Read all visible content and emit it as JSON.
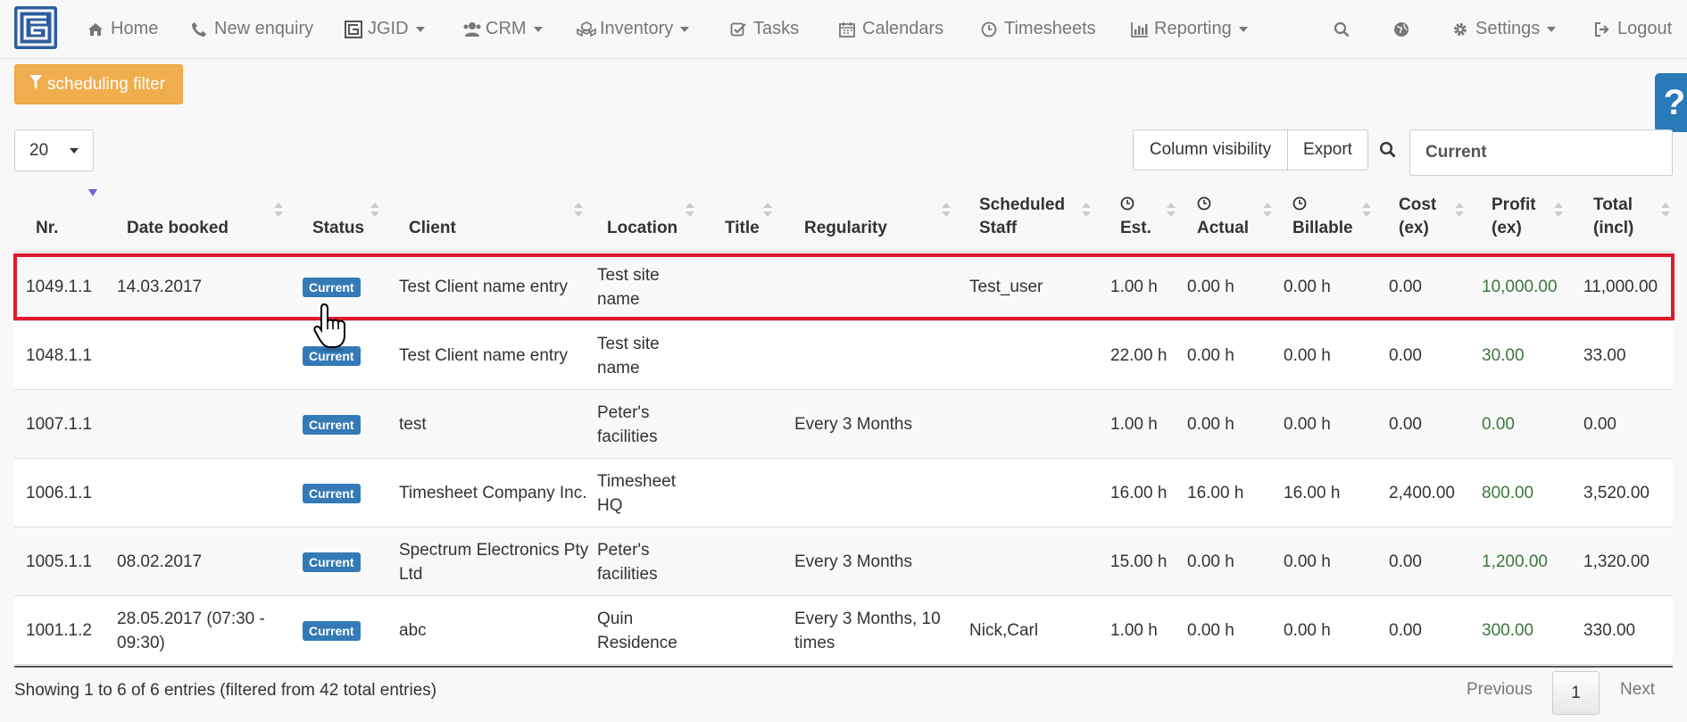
{
  "nav": {
    "home": "Home",
    "new_enquiry": "New enquiry",
    "jgid": "JGID",
    "crm": "CRM",
    "inventory": "Inventory",
    "tasks": "Tasks",
    "calendars": "Calendars",
    "timesheets": "Timesheets",
    "reporting": "Reporting",
    "settings": "Settings",
    "logout": "Logout"
  },
  "filter_button": "scheduling filter",
  "help_label": "?",
  "toolbar": {
    "page_length": "20",
    "column_visibility": "Column visibility",
    "export": "Export",
    "search_value": "Current"
  },
  "table": {
    "headers": {
      "nr": "Nr.",
      "date_booked": "Date booked",
      "status": "Status",
      "client": "Client",
      "location": "Location",
      "title": "Title",
      "regularity": "Regularity",
      "scheduled_staff_1": "Scheduled",
      "scheduled_staff_2": "Staff",
      "est": "Est.",
      "actual": "Actual",
      "billable": "Billable",
      "cost_1": "Cost",
      "cost_2": "(ex)",
      "profit_1": "Profit",
      "profit_2": "(ex)",
      "total_1": "Total",
      "total_2": "(incl)"
    },
    "rows": [
      {
        "nr": "1049.1.1",
        "date": "14.03.2017",
        "status": "Current",
        "client": "Test Client name entry",
        "location": "Test site name",
        "title": "",
        "regularity": "",
        "staff": "Test_user",
        "est": "1.00 h",
        "actual": "0.00 h",
        "billable": "0.00 h",
        "cost": "0.00",
        "profit": "10,000.00",
        "total": "11,000.00"
      },
      {
        "nr": "1048.1.1",
        "date": "",
        "status": "Current",
        "client": "Test Client name entry",
        "location": "Test site name",
        "title": "",
        "regularity": "",
        "staff": "",
        "est": "22.00 h",
        "actual": "0.00 h",
        "billable": "0.00 h",
        "cost": "0.00",
        "profit": "30.00",
        "total": "33.00"
      },
      {
        "nr": "1007.1.1",
        "date": "",
        "status": "Current",
        "client": "test",
        "location": "Peter's facilities",
        "title": "",
        "regularity": "Every 3 Months",
        "staff": "",
        "est": "1.00 h",
        "actual": "0.00 h",
        "billable": "0.00 h",
        "cost": "0.00",
        "profit": "0.00",
        "total": "0.00"
      },
      {
        "nr": "1006.1.1",
        "date": "",
        "status": "Current",
        "client": "Timesheet Company Inc.",
        "location": "Timesheet HQ",
        "title": "",
        "regularity": "",
        "staff": "",
        "est": "16.00 h",
        "actual": "16.00 h",
        "billable": "16.00 h",
        "cost": "2,400.00",
        "profit": "800.00",
        "total": "3,520.00"
      },
      {
        "nr": "1005.1.1",
        "date": "08.02.2017",
        "status": "Current",
        "client": "Spectrum Electronics Pty Ltd",
        "location": "Peter's facilities",
        "title": "",
        "regularity": "Every 3 Months",
        "staff": "",
        "est": "15.00 h",
        "actual": "0.00 h",
        "billable": "0.00 h",
        "cost": "0.00",
        "profit": "1,200.00",
        "total": "1,320.00"
      },
      {
        "nr": "1001.1.2",
        "date": "28.05.2017 (07:30 - 09:30)",
        "status": "Current",
        "client": "abc",
        "location": "Quin Residence",
        "title": "",
        "regularity": "Every 3 Months, 10 times",
        "staff": "Nick,Carl",
        "est": "1.00 h",
        "actual": "0.00 h",
        "billable": "0.00 h",
        "cost": "0.00",
        "profit": "300.00",
        "total": "330.00"
      }
    ]
  },
  "footer": {
    "info": "Showing 1 to 6 of 6 entries (filtered from 42 total entries)",
    "previous": "Previous",
    "page": "1",
    "next": "Next"
  },
  "colors": {
    "status_badge": "#337ab7",
    "profit_text": "#3c763d",
    "filter_button": "#f0ad4e",
    "highlight_border": "#e0192b",
    "logo": "#2d5d9f"
  },
  "icons": [
    "home-icon",
    "phone-icon",
    "jgid-icon",
    "users-icon",
    "cubes-icon",
    "check-square-icon",
    "calendar-icon",
    "clock-icon",
    "bar-chart-icon",
    "search-icon",
    "globe-icon",
    "gear-icon",
    "sign-out-icon",
    "filter-icon",
    "hand-cursor-icon"
  ]
}
